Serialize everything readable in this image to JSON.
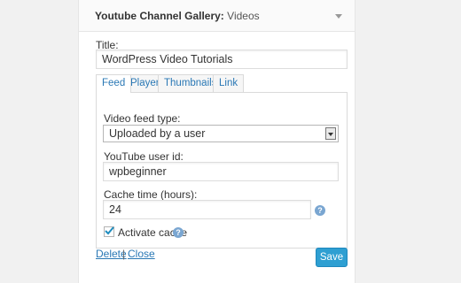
{
  "widget": {
    "title_bold": "Youtube Channel Gallery:",
    "title_sub": "Videos",
    "toggle_icon": "triangle-down-icon"
  },
  "title_field": {
    "label": "Title:",
    "value": "WordPress Video Tutorials"
  },
  "tabs": [
    {
      "label": "Feed",
      "active": true
    },
    {
      "label": "Player",
      "active": false
    },
    {
      "label": "Thumbnails",
      "active": false
    },
    {
      "label": "Link",
      "active": false
    }
  ],
  "feed": {
    "video_feed_label": "Video feed type:",
    "video_feed_selected": "Uploaded by a user",
    "user_id_label": "YouTube user id:",
    "user_id_value": "wpbeginner",
    "cache_label": "Cache time (hours):",
    "cache_value": "24",
    "activate_cache_label": "Activate cache",
    "activate_cache_checked": true,
    "help_glyph": "?"
  },
  "footer": {
    "delete_label": "Delete",
    "separator": "|",
    "close_label": "Close",
    "save_label": "Save"
  },
  "colors": {
    "link": "#2a78b5",
    "save_button": "#2e9fd2",
    "help_icon": "#7aa6d1"
  }
}
